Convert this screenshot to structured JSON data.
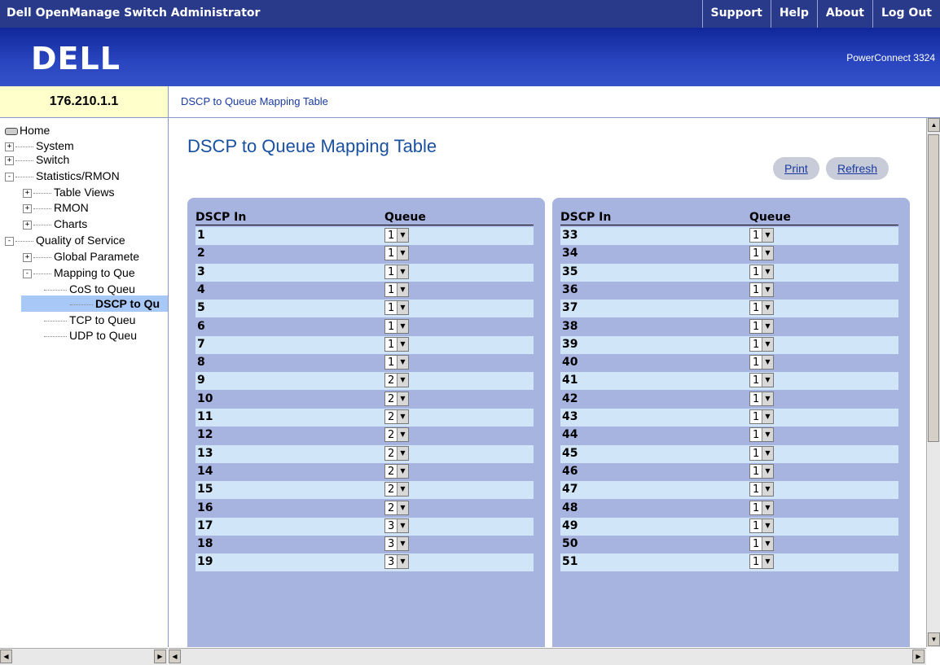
{
  "app": {
    "title": "Dell OpenManage Switch Administrator",
    "top_links": [
      "Support",
      "Help",
      "About",
      "Log Out"
    ],
    "logo": "DELL",
    "model": "PowerConnect 3324"
  },
  "ip": "176.210.1.1",
  "breadcrumb": "DSCP to Queue Mapping Table",
  "tree": [
    {
      "label": "Home",
      "icon": "home-icon"
    },
    {
      "label": "System",
      "expand": "+"
    },
    {
      "label": "Switch",
      "expand": "+"
    },
    {
      "label": "Statistics/RMON",
      "expand": "-"
    },
    {
      "label": "Table Views",
      "expand": "+"
    },
    {
      "label": "RMON",
      "expand": "+"
    },
    {
      "label": "Charts",
      "expand": "+"
    },
    {
      "label": "Quality of Service",
      "expand": "-"
    },
    {
      "label": "Global Paramete",
      "expand": "+"
    },
    {
      "label": "Mapping to Que",
      "expand": "-"
    },
    {
      "label": "CoS to Queu"
    },
    {
      "label": "DSCP to Qu",
      "selected": true
    },
    {
      "label": "TCP to Queu"
    },
    {
      "label": "UDP to Queu"
    }
  ],
  "page": {
    "title": "DSCP to Queue Mapping Table",
    "buttons": {
      "print": "Print",
      "refresh": "Refresh"
    },
    "col_dscp": "DSCP In",
    "col_queue": "Queue"
  },
  "left_table": [
    {
      "dscp": "1",
      "queue": "1"
    },
    {
      "dscp": "2",
      "queue": "1"
    },
    {
      "dscp": "3",
      "queue": "1"
    },
    {
      "dscp": "4",
      "queue": "1"
    },
    {
      "dscp": "5",
      "queue": "1"
    },
    {
      "dscp": "6",
      "queue": "1"
    },
    {
      "dscp": "7",
      "queue": "1"
    },
    {
      "dscp": "8",
      "queue": "1"
    },
    {
      "dscp": "9",
      "queue": "2"
    },
    {
      "dscp": "10",
      "queue": "2"
    },
    {
      "dscp": "11",
      "queue": "2"
    },
    {
      "dscp": "12",
      "queue": "2"
    },
    {
      "dscp": "13",
      "queue": "2"
    },
    {
      "dscp": "14",
      "queue": "2"
    },
    {
      "dscp": "15",
      "queue": "2"
    },
    {
      "dscp": "16",
      "queue": "2"
    },
    {
      "dscp": "17",
      "queue": "3"
    },
    {
      "dscp": "18",
      "queue": "3"
    },
    {
      "dscp": "19",
      "queue": "3"
    }
  ],
  "right_table": [
    {
      "dscp": "33",
      "queue": "1"
    },
    {
      "dscp": "34",
      "queue": "1"
    },
    {
      "dscp": "35",
      "queue": "1"
    },
    {
      "dscp": "36",
      "queue": "1"
    },
    {
      "dscp": "37",
      "queue": "1"
    },
    {
      "dscp": "38",
      "queue": "1"
    },
    {
      "dscp": "39",
      "queue": "1"
    },
    {
      "dscp": "40",
      "queue": "1"
    },
    {
      "dscp": "41",
      "queue": "1"
    },
    {
      "dscp": "42",
      "queue": "1"
    },
    {
      "dscp": "43",
      "queue": "1"
    },
    {
      "dscp": "44",
      "queue": "1"
    },
    {
      "dscp": "45",
      "queue": "1"
    },
    {
      "dscp": "46",
      "queue": "1"
    },
    {
      "dscp": "47",
      "queue": "1"
    },
    {
      "dscp": "48",
      "queue": "1"
    },
    {
      "dscp": "49",
      "queue": "1"
    },
    {
      "dscp": "50",
      "queue": "1"
    },
    {
      "dscp": "51",
      "queue": "1"
    }
  ]
}
